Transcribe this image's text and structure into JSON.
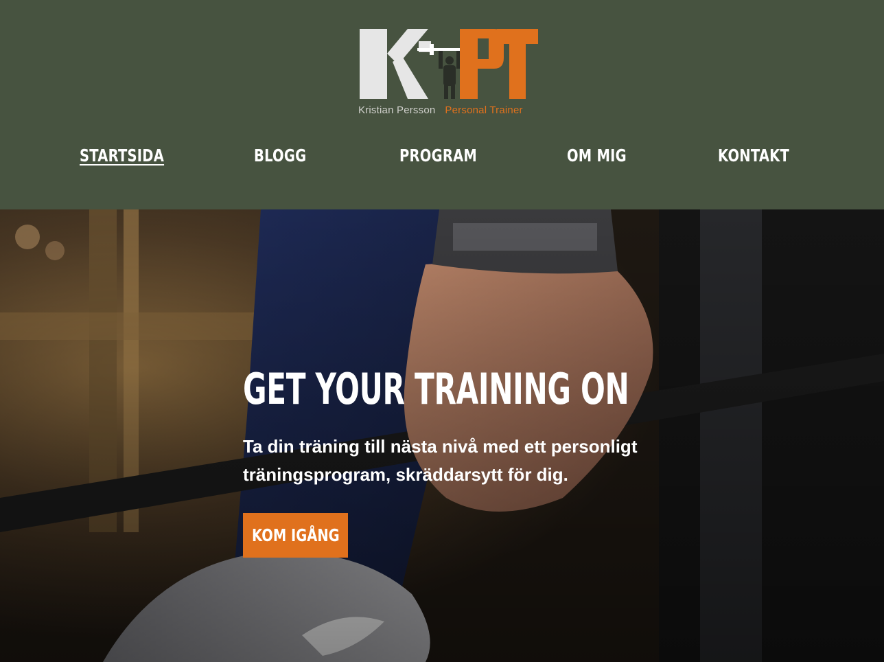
{
  "brand": {
    "logo_letters_left": "K",
    "logo_letters_right": "PT",
    "name": "Kristian Persson",
    "role": "Personal Trainer",
    "colors": {
      "header_bg": "#475340",
      "accent": "#e0711d",
      "logo_light": "#e6e6e6"
    }
  },
  "nav": {
    "items": [
      {
        "label": "STARTSIDA",
        "active": true
      },
      {
        "label": "BLOGG",
        "active": false
      },
      {
        "label": "PROGRAM",
        "active": false
      },
      {
        "label": "OM MIG",
        "active": false
      },
      {
        "label": "KONTAKT",
        "active": false
      }
    ]
  },
  "hero": {
    "title": "GET YOUR TRAINING ON",
    "subtitle": "Ta din träning till nästa nivå med ett personligt träningsprogram, skräddarsytt för dig.",
    "cta_label": "KOM IGÅNG",
    "background_image": "gym-hand-gripping-barbell-photo"
  }
}
